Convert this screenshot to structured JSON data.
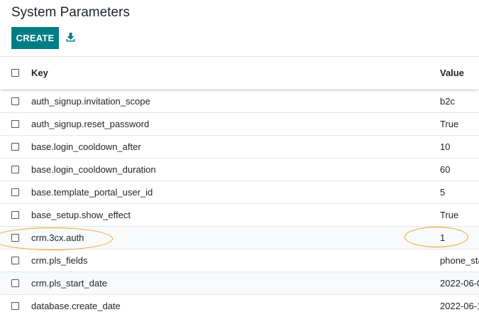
{
  "page": {
    "title": "System Parameters"
  },
  "toolbar": {
    "create_label": "CREATE",
    "download_icon": "download-icon"
  },
  "table": {
    "columns": [
      "Key",
      "Value"
    ],
    "rows": [
      {
        "key": "auth_signup.invitation_scope",
        "value": "b2c"
      },
      {
        "key": "auth_signup.reset_password",
        "value": "True"
      },
      {
        "key": "base.login_cooldown_after",
        "value": "10"
      },
      {
        "key": "base.login_cooldown_duration",
        "value": "60"
      },
      {
        "key": "base.template_portal_user_id",
        "value": "5"
      },
      {
        "key": "base_setup.show_effect",
        "value": "True"
      },
      {
        "key": "crm.3cx.auth",
        "value": "1"
      },
      {
        "key": "crm.pls_fields",
        "value": "phone_sta"
      },
      {
        "key": "crm.pls_start_date",
        "value": "2022-06-0"
      },
      {
        "key": "database.create_date",
        "value": "2022-06-1"
      }
    ]
  },
  "colors": {
    "accent": "#017e84",
    "annotation": "#f19c1f"
  }
}
